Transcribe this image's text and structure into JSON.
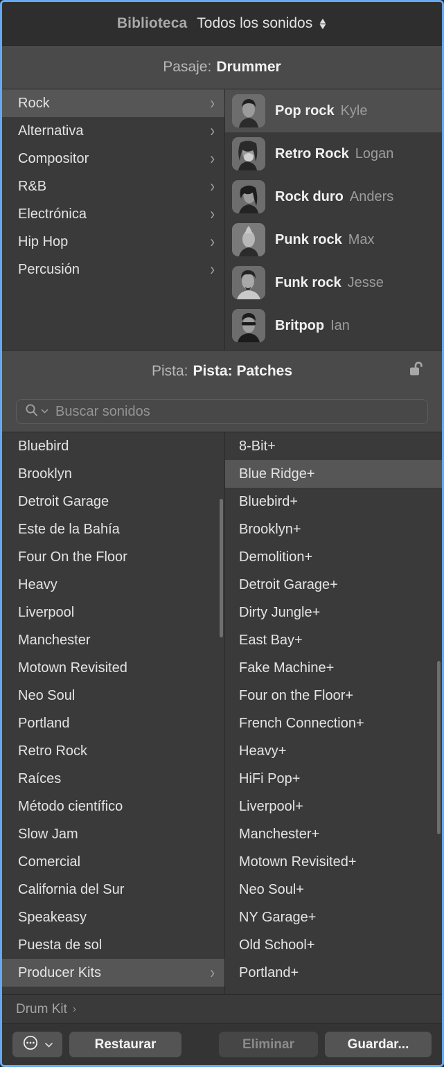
{
  "library": {
    "title": "Biblioteca",
    "filter_value": "Todos los sonidos",
    "filter_icon": "up-down-chevron-icon"
  },
  "patch_header": {
    "prefix": "Pasaje:",
    "value": "Drummer"
  },
  "genres": [
    {
      "label": "Rock",
      "selected": true,
      "chevron": "›"
    },
    {
      "label": "Alternativa",
      "selected": false,
      "chevron": "›"
    },
    {
      "label": "Compositor",
      "selected": false,
      "chevron": "›"
    },
    {
      "label": "R&B",
      "selected": false,
      "chevron": "›"
    },
    {
      "label": "Electrónica",
      "selected": false,
      "chevron": "›"
    },
    {
      "label": "Hip Hop",
      "selected": false,
      "chevron": "›"
    },
    {
      "label": "Percusión",
      "selected": false,
      "chevron": "›"
    }
  ],
  "drummers": [
    {
      "style": "Pop rock",
      "name": "Kyle",
      "selected": true
    },
    {
      "style": "Retro Rock",
      "name": "Logan",
      "selected": false
    },
    {
      "style": "Rock duro",
      "name": "Anders",
      "selected": false
    },
    {
      "style": "Punk rock",
      "name": "Max",
      "selected": false
    },
    {
      "style": "Funk rock",
      "name": "Jesse",
      "selected": false
    },
    {
      "style": "Britpop",
      "name": "Ian",
      "selected": false
    }
  ],
  "track_header": {
    "prefix": "Pista:",
    "value": "Pista: Patches",
    "lock_icon": "unlocked-padlock-icon"
  },
  "search": {
    "placeholder": "Buscar sonidos",
    "value": "",
    "icon": "search-icon",
    "menu_icon": "chevron-down-icon"
  },
  "patches_left": [
    {
      "label": "Bluebird",
      "selected": false,
      "chevron": ""
    },
    {
      "label": "Brooklyn",
      "selected": false,
      "chevron": ""
    },
    {
      "label": "Detroit Garage",
      "selected": false,
      "chevron": ""
    },
    {
      "label": "Este de la Bahía",
      "selected": false,
      "chevron": ""
    },
    {
      "label": "Four On the Floor",
      "selected": false,
      "chevron": ""
    },
    {
      "label": "Heavy",
      "selected": false,
      "chevron": ""
    },
    {
      "label": "Liverpool",
      "selected": false,
      "chevron": ""
    },
    {
      "label": "Manchester",
      "selected": false,
      "chevron": ""
    },
    {
      "label": "Motown Revisited",
      "selected": false,
      "chevron": ""
    },
    {
      "label": "Neo Soul",
      "selected": false,
      "chevron": ""
    },
    {
      "label": "Portland",
      "selected": false,
      "chevron": ""
    },
    {
      "label": "Retro Rock",
      "selected": false,
      "chevron": ""
    },
    {
      "label": "Raíces",
      "selected": false,
      "chevron": ""
    },
    {
      "label": "Método científico",
      "selected": false,
      "chevron": ""
    },
    {
      "label": "Slow Jam",
      "selected": false,
      "chevron": ""
    },
    {
      "label": "Comercial",
      "selected": false,
      "chevron": ""
    },
    {
      "label": "California del Sur",
      "selected": false,
      "chevron": ""
    },
    {
      "label": "Speakeasy",
      "selected": false,
      "chevron": ""
    },
    {
      "label": "Puesta de sol",
      "selected": false,
      "chevron": ""
    },
    {
      "label": "Producer Kits",
      "selected": true,
      "chevron": "›"
    }
  ],
  "patches_right": [
    {
      "label": "8-Bit+",
      "selected": false
    },
    {
      "label": "Blue Ridge+",
      "selected": true
    },
    {
      "label": "Bluebird+",
      "selected": false
    },
    {
      "label": "Brooklyn+",
      "selected": false
    },
    {
      "label": "Demolition+",
      "selected": false
    },
    {
      "label": "Detroit Garage+",
      "selected": false
    },
    {
      "label": "Dirty Jungle+",
      "selected": false
    },
    {
      "label": "East Bay+",
      "selected": false
    },
    {
      "label": "Fake Machine+",
      "selected": false
    },
    {
      "label": "Four on the Floor+",
      "selected": false
    },
    {
      "label": "French Connection+",
      "selected": false
    },
    {
      "label": "Heavy+",
      "selected": false
    },
    {
      "label": "HiFi Pop+",
      "selected": false
    },
    {
      "label": "Liverpool+",
      "selected": false
    },
    {
      "label": "Manchester+",
      "selected": false
    },
    {
      "label": "Motown Revisited+",
      "selected": false
    },
    {
      "label": "Neo Soul+",
      "selected": false
    },
    {
      "label": "NY Garage+",
      "selected": false
    },
    {
      "label": "Old School+",
      "selected": false
    },
    {
      "label": "Portland+",
      "selected": false
    }
  ],
  "breadcrumb": {
    "label": "Drum Kit",
    "chevron": "›"
  },
  "buttons": {
    "menu_icon": "ellipsis-circle-icon",
    "menu_chevron": "chevron-down-icon",
    "restore": "Restaurar",
    "delete": "Eliminar",
    "save": "Guardar...",
    "delete_disabled": true
  },
  "colors": {
    "window_border": "#64a9f0",
    "panel_bg": "#3a3a3a",
    "header_bg": "#4a4a4a",
    "titlebar_bg": "#2e2e2e",
    "selected_row": "#565656",
    "text_primary": "#e4e4e4",
    "text_secondary": "#9c9c9c"
  }
}
